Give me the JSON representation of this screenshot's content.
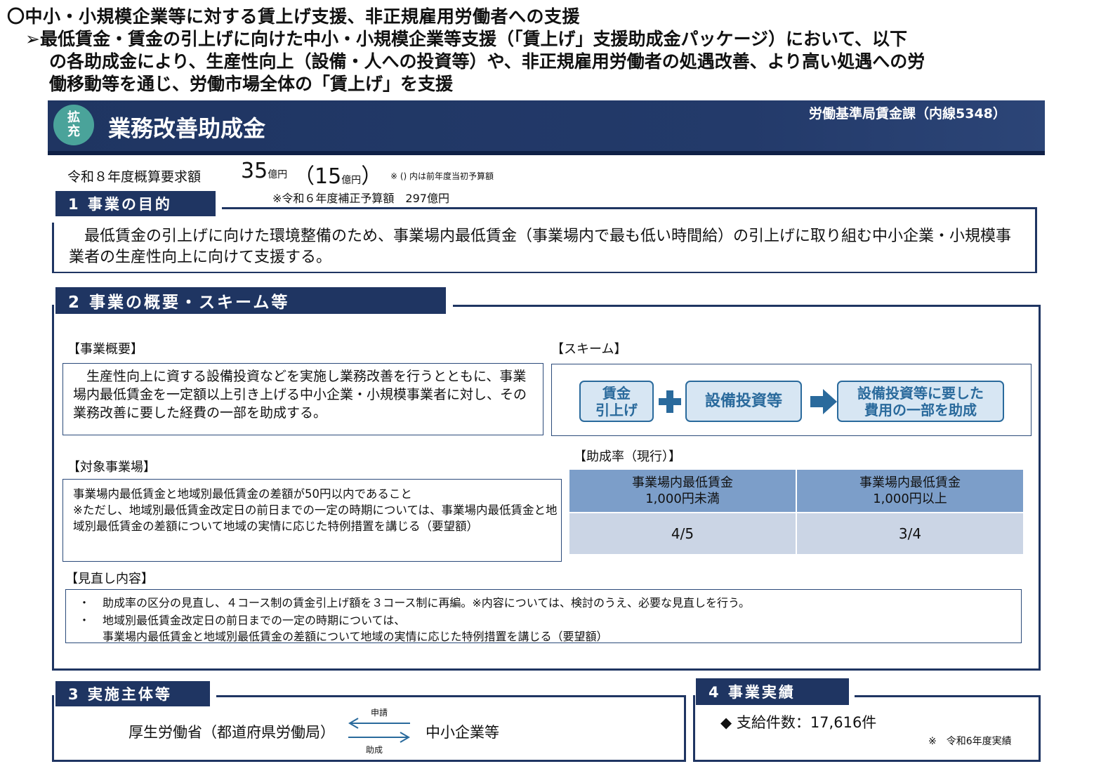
{
  "header": {
    "line1": "〇中小・小規模企業等に対する賃上げ支援、非正規雇用労働者への支援",
    "line2": "➢最低賃金・賃金の引上げに向けた中小・小規模企業等支援（「賃上げ」支援助成金パッケージ）において、以下",
    "line3": "の各助成金により、生産性向上（設備・人への投資等）や、非正規雇用労働者の処遇改善、より高い処遇への労",
    "line4": "働移動等を通じ、労働市場全体の「賃上げ」を支援"
  },
  "title": {
    "badge_top": "拡",
    "badge_bottom": "充",
    "name": "業務改善助成金",
    "department": "労働基準局賃金課（内線5348）"
  },
  "budget": {
    "label": "令和８年度概算要求額",
    "amount": "35",
    "unit": "億円",
    "prev_open": "（15",
    "prev_unit": "億円",
    "prev_close": "）",
    "note": "※ () 内は前年度当初予算額",
    "supplementary": "※令和６年度補正予算額　297億円"
  },
  "section1": {
    "label": "1  事業の目的",
    "text": "　最低賃金の引上げに向けた環境整備のため、事業場内最低賃金（事業場内で最も低い時間給）の引上げに取り組む中小企業・小規模事業者の生産性向上に向けて支援する。"
  },
  "section2": {
    "label": "2  事業の概要・スキーム等",
    "overview_title": "【事業概要】",
    "overview_text": "　生産性向上に資する設備投資などを実施し業務改善を行うとともに、事業場内最低賃金を一定額以上引き上げる中小企業・小規模事業者に対し、その業務改善に要した経費の一部を助成する。",
    "scheme_title": "【スキーム】",
    "scheme": {
      "step1_line1": "賃金",
      "step1_line2": "引上げ",
      "plus_icon": "plus-icon",
      "step2": "設備投資等",
      "arrow_icon": "arrow-right-icon",
      "step3_line1": "設備投資等に要した",
      "step3_line2": "費用の一部を助成"
    },
    "rate_title": "【助成率（現行）】",
    "rate_table": {
      "headers": [
        {
          "line1": "事業場内最低賃金",
          "line2": "1,000円未満"
        },
        {
          "line1": "事業場内最低賃金",
          "line2": "1,000円以上"
        }
      ],
      "values": [
        "4/5",
        "3/4"
      ]
    },
    "target_title": "【対象事業場】",
    "target_line1": "事業場内最低賃金と地域別最低賃金の差額が50円以内であること",
    "target_line2": "※ただし、地域別最低賃金改定日の前日までの一定の時期については、事業場内最低賃金と地域別最低賃金の差額について地域の実情に応じた特例措置を講じる（要望額）",
    "review_title": "【見直し内容】",
    "review_bullet": "・",
    "review_item1": "助成率の区分の見直し、４コース制の賃金引上げ額を３コース制に再編。※内容については、検討のうえ、必要な見直しを行う。",
    "review_item2_line1": "地域別最低賃金改定日の前日までの一定の時期については、",
    "review_item2_line2": "事業場内最低賃金と地域別最低賃金の差額について地域の実情に応じた特例措置を講じる（要望額）"
  },
  "section3": {
    "label": "3  実施主体等",
    "left_party": "厚生労働省（都道府県労働局）",
    "apply_label": "申請",
    "grant_label": "助成",
    "right_party": "中小企業等"
  },
  "section4": {
    "label": "4  事業実績",
    "result": "◆ 支給件数：17,616件",
    "note": "※　令和6年度実績"
  },
  "colors": {
    "navy": "#1f3562",
    "badge_teal": "#4aa39a",
    "pill_fill": "#d7e6f3",
    "pill_blue": "#2a6a9c",
    "table_header": "#7c9ec9",
    "table_value": "#cbd5e5"
  }
}
